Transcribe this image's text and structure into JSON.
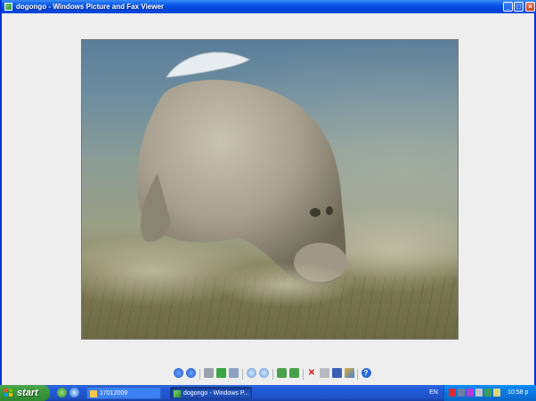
{
  "window": {
    "title": "dogongo - Windows Picture and Fax Viewer",
    "controls": {
      "minimize": "_",
      "maximize": "□",
      "close": "×"
    }
  },
  "toolbar": {
    "buttons": [
      {
        "name": "previous-image",
        "icon": "arrow-left-circle-icon"
      },
      {
        "name": "next-image",
        "icon": "arrow-right-circle-icon"
      },
      {
        "name": "best-fit",
        "icon": "best-fit-icon"
      },
      {
        "name": "actual-size",
        "icon": "actual-size-icon"
      },
      {
        "name": "slideshow",
        "icon": "slideshow-icon"
      },
      {
        "name": "zoom-in",
        "icon": "magnifier-plus-icon"
      },
      {
        "name": "zoom-out",
        "icon": "magnifier-minus-icon"
      },
      {
        "name": "rotate-clockwise",
        "icon": "rotate-cw-icon"
      },
      {
        "name": "rotate-counterclockwise",
        "icon": "rotate-ccw-icon"
      },
      {
        "name": "delete",
        "icon": "red-x-icon"
      },
      {
        "name": "print",
        "icon": "printer-icon"
      },
      {
        "name": "save",
        "icon": "floppy-icon"
      },
      {
        "name": "edit",
        "icon": "paint-icon"
      },
      {
        "name": "help",
        "icon": "question-icon"
      }
    ],
    "delete_glyph": "✕",
    "help_glyph": "?"
  },
  "taskbar": {
    "start_label": "start",
    "tasks": [
      {
        "label": "17012009",
        "icon": "folder-icon",
        "active": false
      },
      {
        "label": "dogongo - Windows P...",
        "icon": "picture-viewer-icon",
        "active": true
      }
    ],
    "language": "EN",
    "clock": "10:58 p"
  },
  "colors": {
    "titlebar": "#0a5bea",
    "taskbar": "#245edc",
    "start": "#3c9a3c",
    "tray": "#0b77e2",
    "window_bg": "#eeeeee"
  }
}
